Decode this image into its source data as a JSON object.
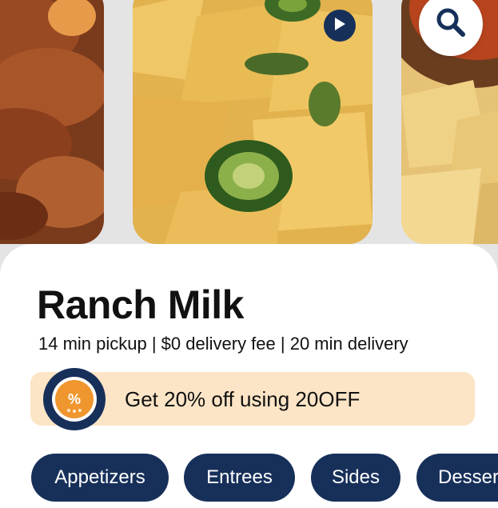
{
  "restaurant": {
    "name": "Ranch Milk",
    "meta": "14 min pickup | $0 delivery fee | 20 min delivery"
  },
  "promo": {
    "text": "Get 20% off using 20OFF",
    "badge_symbol": "%",
    "badge_color": "#f0962e"
  },
  "categories": [
    "Appetizers",
    "Entrees",
    "Sides",
    "Desserts"
  ],
  "icons": {
    "play": "play-icon",
    "search": "search-icon"
  },
  "colors": {
    "accent": "#17305a",
    "promo_background": "#fbe5c6"
  }
}
